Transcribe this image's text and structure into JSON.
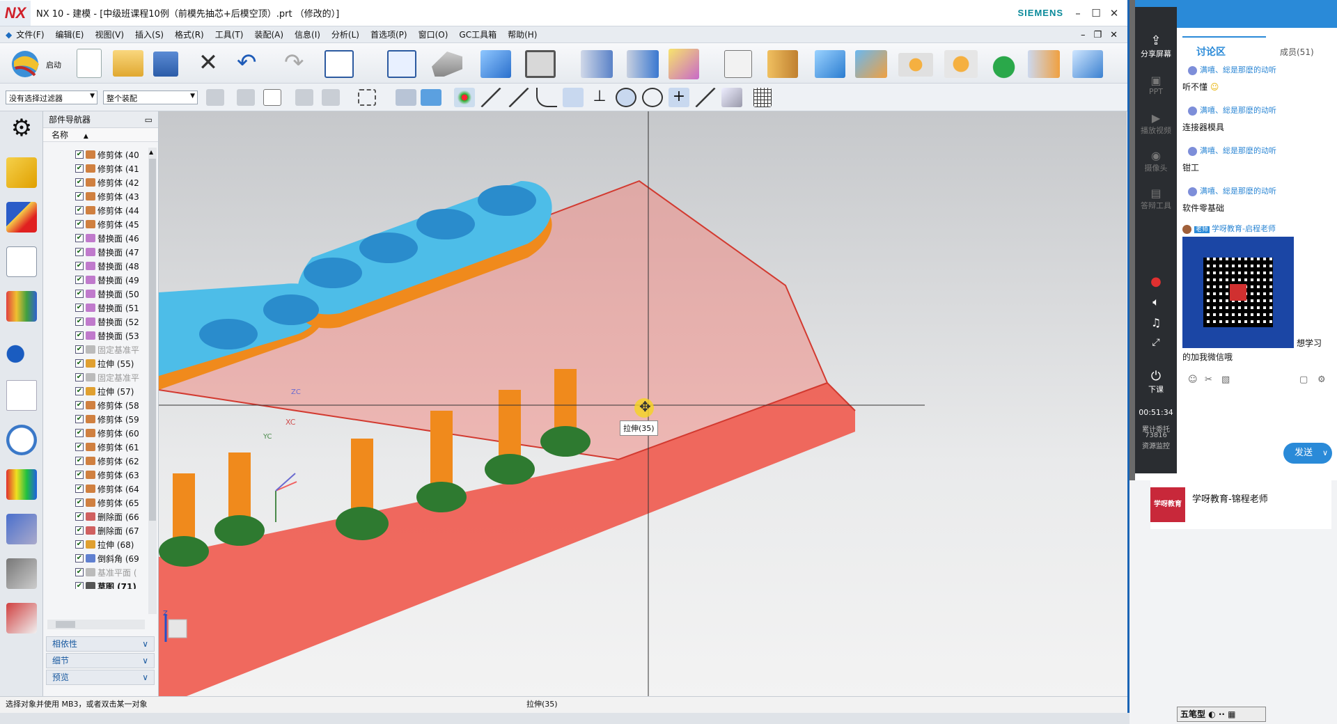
{
  "app": {
    "logo": "NX",
    "title": "NX 10 - 建模 - [中级班课程10例（前模先抽芯+后模空顶）.prt （修改的）]",
    "brand": "SIEMENS"
  },
  "menu": [
    "文件(F)",
    "编辑(E)",
    "视图(V)",
    "插入(S)",
    "格式(R)",
    "工具(T)",
    "装配(A)",
    "信息(I)",
    "分析(L)",
    "首选项(P)",
    "窗口(O)",
    "GC工具箱",
    "帮助(H)"
  ],
  "toolbar": {
    "start_label": "启动",
    "filter_select": "没有选择过滤器",
    "assembly_select": "整个装配"
  },
  "navigator": {
    "title": "部件导航器",
    "column": "名称",
    "rows": [
      {
        "label": "修剪体 (40",
        "type": "trim",
        "checked": true
      },
      {
        "label": "修剪体 (41",
        "type": "trim",
        "checked": true
      },
      {
        "label": "修剪体 (42",
        "type": "trim",
        "checked": true
      },
      {
        "label": "修剪体 (43",
        "type": "trim",
        "checked": true
      },
      {
        "label": "修剪体 (44",
        "type": "trim",
        "checked": true
      },
      {
        "label": "修剪体 (45",
        "type": "trim",
        "checked": true
      },
      {
        "label": "替换面 (46",
        "type": "replace",
        "checked": true
      },
      {
        "label": "替换面 (47",
        "type": "replace",
        "checked": true
      },
      {
        "label": "替换面 (48",
        "type": "replace",
        "checked": true
      },
      {
        "label": "替换面 (49",
        "type": "replace",
        "checked": true
      },
      {
        "label": "替换面 (50",
        "type": "replace",
        "checked": true
      },
      {
        "label": "替换面 (51",
        "type": "replace",
        "checked": true
      },
      {
        "label": "替换面 (52",
        "type": "replace",
        "checked": true
      },
      {
        "label": "替换面 (53",
        "type": "replace",
        "checked": true
      },
      {
        "label": "固定基准平",
        "type": "datum",
        "checked": true
      },
      {
        "label": "拉伸 (55)",
        "type": "extrude",
        "checked": true
      },
      {
        "label": "固定基准平",
        "type": "datum",
        "checked": true
      },
      {
        "label": "拉伸 (57)",
        "type": "extrude",
        "checked": true
      },
      {
        "label": "修剪体 (58",
        "type": "trim",
        "checked": true
      },
      {
        "label": "修剪体 (59",
        "type": "trim",
        "checked": true
      },
      {
        "label": "修剪体 (60",
        "type": "trim",
        "checked": true
      },
      {
        "label": "修剪体 (61",
        "type": "trim",
        "checked": true
      },
      {
        "label": "修剪体 (62",
        "type": "trim",
        "checked": true
      },
      {
        "label": "修剪体 (63",
        "type": "trim",
        "checked": true
      },
      {
        "label": "修剪体 (64",
        "type": "trim",
        "checked": true
      },
      {
        "label": "修剪体 (65",
        "type": "trim",
        "checked": true
      },
      {
        "label": "删除面 (66",
        "type": "delete",
        "checked": true
      },
      {
        "label": "删除面 (67",
        "type": "delete",
        "checked": true
      },
      {
        "label": "拉伸 (68)",
        "type": "extrude",
        "checked": true
      },
      {
        "label": "倒斜角 (69",
        "type": "chamfer",
        "checked": true
      },
      {
        "label": "基准平面 (",
        "type": "datum",
        "checked": true
      },
      {
        "label": "草图 (71)",
        "type": "sketch",
        "checked": true
      }
    ],
    "panels": [
      "相依性",
      "细节",
      "预览"
    ]
  },
  "viewport": {
    "tooltip": "拉伸(35)",
    "axis_xc": "XC",
    "axis_yc": "YC",
    "axis_zc": "ZC",
    "triad_z": "Z"
  },
  "status": {
    "prompt": "选择对象并使用 MB3，或者双击某一对象",
    "selection": "拉伸(35)"
  },
  "chat": {
    "sidebar": [
      "分享屏幕",
      "PPT",
      "播放视频",
      "摄像头",
      "答辩工具"
    ],
    "end_class": "下课",
    "timer": "00:51:34",
    "count_label": "累计委托",
    "count_value": "73816",
    "monitor": "资源监控",
    "tab_discussion": "讨论区",
    "tab_members": "成员(51)",
    "messages": [
      {
        "name": "满嘻、総是那麽的动听",
        "text": "听不懂"
      },
      {
        "name": "满嘻、総是那麽的动听",
        "text": "连接器模具"
      },
      {
        "name": "满嘻、総是那麽的动听",
        "text": "钳工"
      },
      {
        "name": "满嘻、総是那麽的动听",
        "text": "软件零基础"
      }
    ],
    "teacher_msg": "学呀教育-启程老师",
    "teacher_tag": "老师",
    "qr_caption_right": "想学习",
    "qr_caption": "的加我微信哦",
    "send": "发送",
    "teacher_card": "学呀教育-锦程老师",
    "teacher_avatar_text": "学呀教育"
  },
  "ime": "五笔型",
  "colors": {
    "accent": "#2a8ad8",
    "mold_red": "#f05a4e",
    "plate_blue": "#4dbde8",
    "pin_orange": "#f08a1c"
  }
}
